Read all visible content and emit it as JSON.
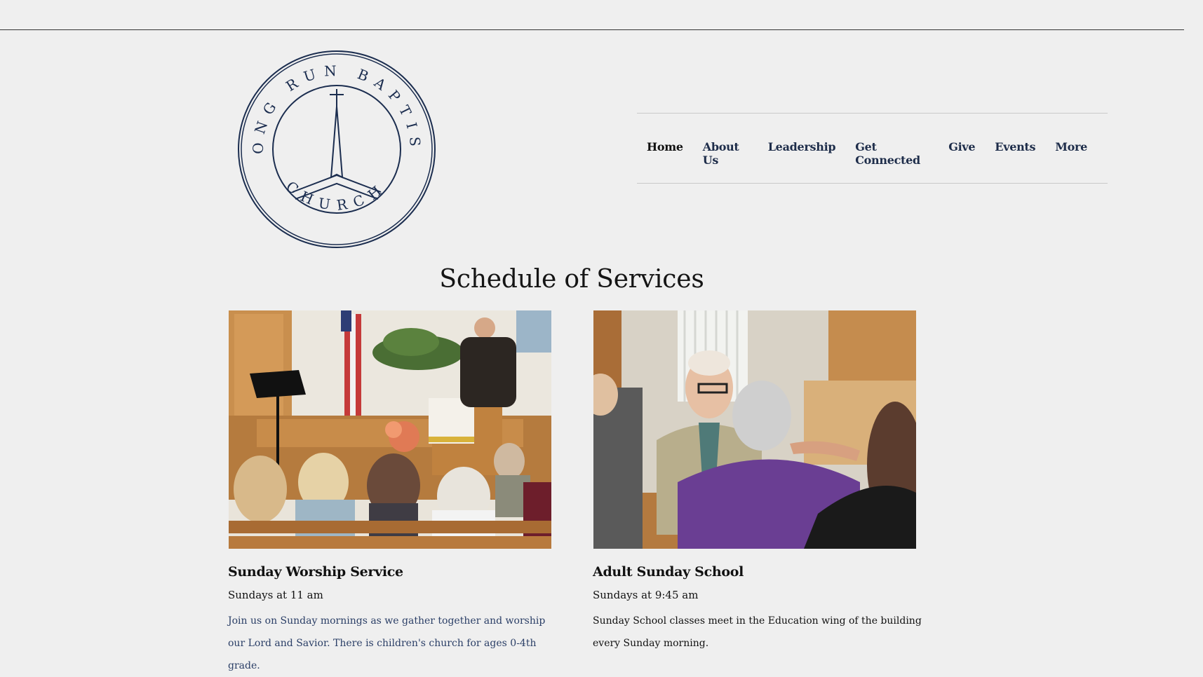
{
  "brand": {
    "logo_text_top": "LONG RUN BAPTIST",
    "logo_text_bottom": "CHURCH",
    "logo_color": "#1b2d4f"
  },
  "nav": {
    "items": [
      {
        "label": "Home",
        "active": true
      },
      {
        "label": "About Us"
      },
      {
        "label": "Leadership"
      },
      {
        "label": "Get Connected"
      },
      {
        "label": "Give"
      },
      {
        "label": "Events"
      },
      {
        "label": "More"
      }
    ]
  },
  "page": {
    "heading": "Schedule of Services"
  },
  "services": [
    {
      "title": "Sunday Worship Service",
      "time": "Sundays at 11 am",
      "description": "Join us on Sunday mornings as we gather together and worship our Lord and Savior. There is children's church for ages 0-4th grade.",
      "image": "worship-service-photo"
    },
    {
      "title": "Adult Sunday School",
      "time": "Sundays at 9:45 am",
      "description": "Sunday School classes meet in the Education wing of the building every Sunday morning.",
      "image": "sunday-school-photo"
    }
  ]
}
